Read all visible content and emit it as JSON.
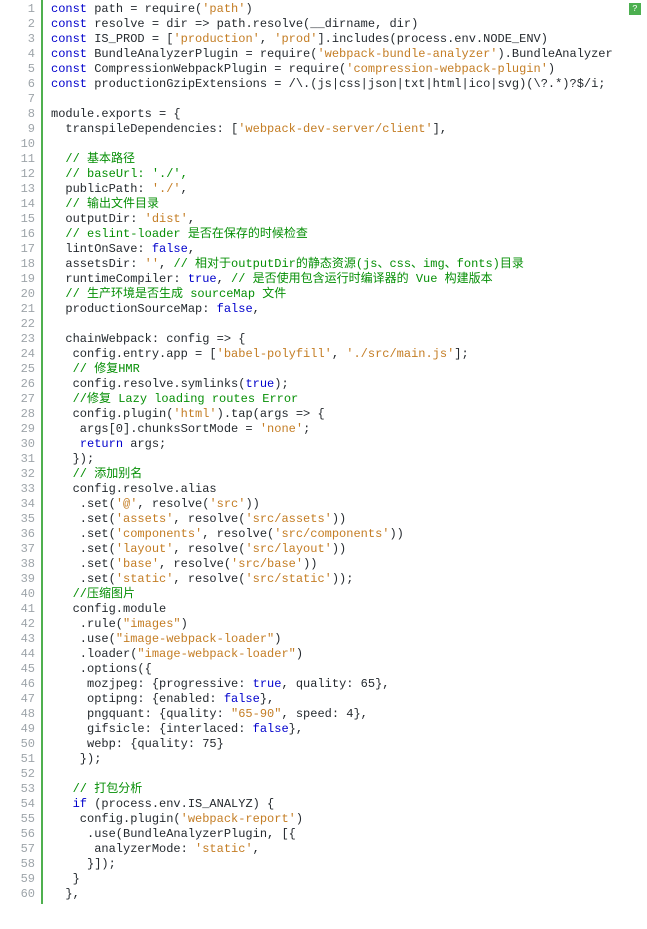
{
  "badge": "?",
  "lines": [
    {
      "n": 1,
      "segs": [
        [
          "kw",
          "const"
        ],
        [
          "",
          " path = require("
        ],
        [
          "str",
          "'path'"
        ],
        [
          "",
          ")"
        ]
      ]
    },
    {
      "n": 2,
      "segs": [
        [
          "kw",
          "const"
        ],
        [
          "",
          " resolve = dir => path.resolve(__dirname, dir)"
        ]
      ]
    },
    {
      "n": 3,
      "segs": [
        [
          "kw",
          "const"
        ],
        [
          "",
          " IS_PROD = ["
        ],
        [
          "str",
          "'production'"
        ],
        [
          "",
          ", "
        ],
        [
          "str",
          "'prod'"
        ],
        [
          "",
          "].includes(process.env.NODE_ENV)"
        ]
      ]
    },
    {
      "n": 4,
      "segs": [
        [
          "kw",
          "const"
        ],
        [
          "",
          " BundleAnalyzerPlugin = require("
        ],
        [
          "str",
          "'webpack-bundle-analyzer'"
        ],
        [
          "",
          ").BundleAnalyzer"
        ]
      ]
    },
    {
      "n": 5,
      "segs": [
        [
          "kw",
          "const"
        ],
        [
          "",
          " CompressionWebpackPlugin = require("
        ],
        [
          "str",
          "'compression-webpack-plugin'"
        ],
        [
          "",
          ")"
        ]
      ]
    },
    {
      "n": 6,
      "segs": [
        [
          "kw",
          "const"
        ],
        [
          "",
          " productionGzipExtensions = /\\.(js|css|json|txt|html|ico|svg)(\\?.*)?$/i;"
        ]
      ]
    },
    {
      "n": 7,
      "segs": [
        [
          "",
          ""
        ]
      ]
    },
    {
      "n": 8,
      "segs": [
        [
          "",
          "module.exports = {"
        ]
      ]
    },
    {
      "n": 9,
      "segs": [
        [
          "",
          "  transpileDependencies: ["
        ],
        [
          "str",
          "'webpack-dev-server/client'"
        ],
        [
          "",
          "],"
        ]
      ]
    },
    {
      "n": 10,
      "segs": [
        [
          "",
          ""
        ]
      ]
    },
    {
      "n": 11,
      "segs": [
        [
          "",
          "  "
        ],
        [
          "cmt",
          "// 基本路径"
        ]
      ]
    },
    {
      "n": 12,
      "segs": [
        [
          "",
          "  "
        ],
        [
          "cmt",
          "// baseUrl: './',"
        ]
      ]
    },
    {
      "n": 13,
      "segs": [
        [
          "",
          "  publicPath: "
        ],
        [
          "str",
          "'./'"
        ],
        [
          "",
          ","
        ]
      ]
    },
    {
      "n": 14,
      "segs": [
        [
          "",
          "  "
        ],
        [
          "cmt",
          "// 输出文件目录"
        ]
      ]
    },
    {
      "n": 15,
      "segs": [
        [
          "",
          "  outputDir: "
        ],
        [
          "str",
          "'dist'"
        ],
        [
          "",
          ","
        ]
      ]
    },
    {
      "n": 16,
      "segs": [
        [
          "",
          "  "
        ],
        [
          "cmt",
          "// eslint-loader 是否在保存的时候检查"
        ]
      ]
    },
    {
      "n": 17,
      "segs": [
        [
          "",
          "  lintOnSave: "
        ],
        [
          "bool",
          "false"
        ],
        [
          "",
          ","
        ]
      ]
    },
    {
      "n": 18,
      "segs": [
        [
          "",
          "  assetsDir: "
        ],
        [
          "str",
          "''"
        ],
        [
          "",
          ", "
        ],
        [
          "cmt",
          "// 相对于outputDir的静态资源(js、css、img、fonts)目录"
        ]
      ]
    },
    {
      "n": 19,
      "segs": [
        [
          "",
          "  runtimeCompiler: "
        ],
        [
          "bool",
          "true"
        ],
        [
          "",
          ", "
        ],
        [
          "cmt",
          "// 是否使用包含运行时编译器的 Vue 构建版本"
        ]
      ]
    },
    {
      "n": 20,
      "segs": [
        [
          "",
          "  "
        ],
        [
          "cmt",
          "// 生产环境是否生成 sourceMap 文件"
        ]
      ]
    },
    {
      "n": 21,
      "segs": [
        [
          "",
          "  productionSourceMap: "
        ],
        [
          "bool",
          "false"
        ],
        [
          "",
          ","
        ]
      ]
    },
    {
      "n": 22,
      "segs": [
        [
          "",
          ""
        ]
      ]
    },
    {
      "n": 23,
      "segs": [
        [
          "",
          "  chainWebpack: config => {"
        ]
      ]
    },
    {
      "n": 24,
      "segs": [
        [
          "",
          "   config.entry.app = ["
        ],
        [
          "str",
          "'babel-polyfill'"
        ],
        [
          "",
          ", "
        ],
        [
          "str",
          "'./src/main.js'"
        ],
        [
          "",
          "];"
        ]
      ]
    },
    {
      "n": 25,
      "segs": [
        [
          "",
          "   "
        ],
        [
          "cmt",
          "// 修复HMR"
        ]
      ]
    },
    {
      "n": 26,
      "segs": [
        [
          "",
          "   config.resolve.symlinks("
        ],
        [
          "bool",
          "true"
        ],
        [
          "",
          ");"
        ]
      ]
    },
    {
      "n": 27,
      "segs": [
        [
          "",
          "   "
        ],
        [
          "cmt",
          "//修复 Lazy loading routes Error"
        ]
      ]
    },
    {
      "n": 28,
      "segs": [
        [
          "",
          "   config.plugin("
        ],
        [
          "str",
          "'html'"
        ],
        [
          "",
          ").tap(args => {"
        ]
      ]
    },
    {
      "n": 29,
      "segs": [
        [
          "",
          "    args[0].chunksSortMode = "
        ],
        [
          "str",
          "'none'"
        ],
        [
          "",
          ";"
        ]
      ]
    },
    {
      "n": 30,
      "segs": [
        [
          "",
          "    "
        ],
        [
          "kw",
          "return"
        ],
        [
          "",
          " args;"
        ]
      ]
    },
    {
      "n": 31,
      "segs": [
        [
          "",
          "   });"
        ]
      ]
    },
    {
      "n": 32,
      "segs": [
        [
          "",
          "   "
        ],
        [
          "cmt",
          "// 添加别名"
        ]
      ]
    },
    {
      "n": 33,
      "segs": [
        [
          "",
          "   config.resolve.alias"
        ]
      ]
    },
    {
      "n": 34,
      "segs": [
        [
          "",
          "    .set("
        ],
        [
          "str",
          "'@'"
        ],
        [
          "",
          ", resolve("
        ],
        [
          "str",
          "'src'"
        ],
        [
          "",
          "))"
        ]
      ]
    },
    {
      "n": 35,
      "segs": [
        [
          "",
          "    .set("
        ],
        [
          "str",
          "'assets'"
        ],
        [
          "",
          ", resolve("
        ],
        [
          "str",
          "'src/assets'"
        ],
        [
          "",
          "))"
        ]
      ]
    },
    {
      "n": 36,
      "segs": [
        [
          "",
          "    .set("
        ],
        [
          "str",
          "'components'"
        ],
        [
          "",
          ", resolve("
        ],
        [
          "str",
          "'src/components'"
        ],
        [
          "",
          "))"
        ]
      ]
    },
    {
      "n": 37,
      "segs": [
        [
          "",
          "    .set("
        ],
        [
          "str",
          "'layout'"
        ],
        [
          "",
          ", resolve("
        ],
        [
          "str",
          "'src/layout'"
        ],
        [
          "",
          "))"
        ]
      ]
    },
    {
      "n": 38,
      "segs": [
        [
          "",
          "    .set("
        ],
        [
          "str",
          "'base'"
        ],
        [
          "",
          ", resolve("
        ],
        [
          "str",
          "'src/base'"
        ],
        [
          "",
          "))"
        ]
      ]
    },
    {
      "n": 39,
      "segs": [
        [
          "",
          "    .set("
        ],
        [
          "str",
          "'static'"
        ],
        [
          "",
          ", resolve("
        ],
        [
          "str",
          "'src/static'"
        ],
        [
          "",
          "));"
        ]
      ]
    },
    {
      "n": 40,
      "segs": [
        [
          "",
          "   "
        ],
        [
          "cmt",
          "//压缩图片"
        ]
      ]
    },
    {
      "n": 41,
      "segs": [
        [
          "",
          "   config.module"
        ]
      ]
    },
    {
      "n": 42,
      "segs": [
        [
          "",
          "    .rule("
        ],
        [
          "str",
          "\"images\""
        ],
        [
          "",
          ")"
        ]
      ]
    },
    {
      "n": 43,
      "segs": [
        [
          "",
          "    .use("
        ],
        [
          "str",
          "\"image-webpack-loader\""
        ],
        [
          "",
          ")"
        ]
      ]
    },
    {
      "n": 44,
      "segs": [
        [
          "",
          "    .loader("
        ],
        [
          "str",
          "\"image-webpack-loader\""
        ],
        [
          "",
          ")"
        ]
      ]
    },
    {
      "n": 45,
      "segs": [
        [
          "",
          "    .options({"
        ]
      ]
    },
    {
      "n": 46,
      "segs": [
        [
          "",
          "     mozjpeg: {progressive: "
        ],
        [
          "bool",
          "true"
        ],
        [
          "",
          ", quality: 65},"
        ]
      ]
    },
    {
      "n": 47,
      "segs": [
        [
          "",
          "     optipng: {enabled: "
        ],
        [
          "bool",
          "false"
        ],
        [
          "",
          "},"
        ]
      ]
    },
    {
      "n": 48,
      "segs": [
        [
          "",
          "     pngquant: {quality: "
        ],
        [
          "str",
          "\"65-90\""
        ],
        [
          "",
          ", speed: 4},"
        ]
      ]
    },
    {
      "n": 49,
      "segs": [
        [
          "",
          "     gifsicle: {interlaced: "
        ],
        [
          "bool",
          "false"
        ],
        [
          "",
          "},"
        ]
      ]
    },
    {
      "n": 50,
      "segs": [
        [
          "",
          "     webp: {quality: 75}"
        ]
      ]
    },
    {
      "n": 51,
      "segs": [
        [
          "",
          "    });"
        ]
      ]
    },
    {
      "n": 52,
      "segs": [
        [
          "",
          ""
        ]
      ]
    },
    {
      "n": 53,
      "segs": [
        [
          "",
          "   "
        ],
        [
          "cmt",
          "// 打包分析"
        ]
      ]
    },
    {
      "n": 54,
      "segs": [
        [
          "",
          "   "
        ],
        [
          "kw",
          "if"
        ],
        [
          "",
          " (process.env.IS_ANALYZ) {"
        ]
      ]
    },
    {
      "n": 55,
      "segs": [
        [
          "",
          "    config.plugin("
        ],
        [
          "str",
          "'webpack-report'"
        ],
        [
          "",
          ")"
        ]
      ]
    },
    {
      "n": 56,
      "segs": [
        [
          "",
          "     .use(BundleAnalyzerPlugin, [{"
        ]
      ]
    },
    {
      "n": 57,
      "segs": [
        [
          "",
          "      analyzerMode: "
        ],
        [
          "str",
          "'static'"
        ],
        [
          "",
          ","
        ]
      ]
    },
    {
      "n": 58,
      "segs": [
        [
          "",
          "     }]);"
        ]
      ]
    },
    {
      "n": 59,
      "segs": [
        [
          "",
          "   }"
        ]
      ]
    },
    {
      "n": 60,
      "segs": [
        [
          "",
          "  },"
        ]
      ]
    }
  ]
}
